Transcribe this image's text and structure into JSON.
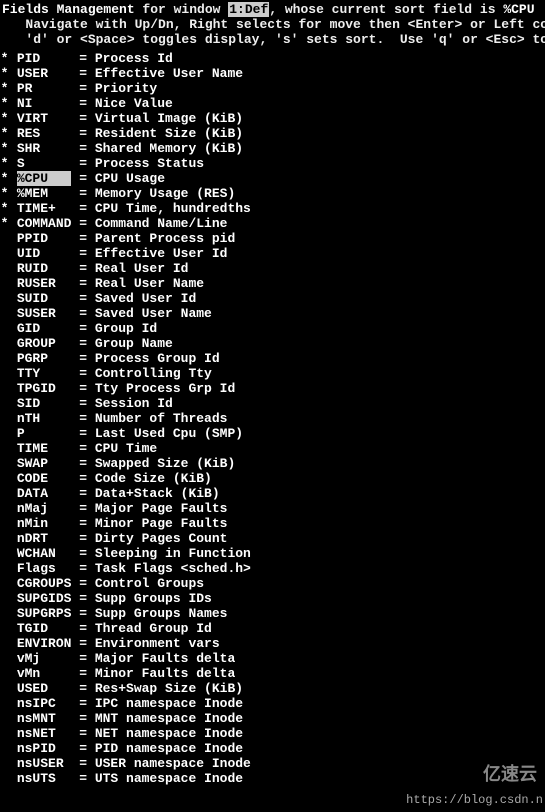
{
  "header": {
    "title": "Fields Management",
    "for_window_prefix": " for window ",
    "window": "1:Def",
    "sort_prefix": ", whose current sort field is ",
    "sort_field": "%CPU",
    "instr1": "   Navigate with Up/Dn, Right selects for move then <Enter> or Left commits,",
    "instr2": "   'd' or <Space> toggles display, 's' sets sort.  Use 'q' or <Esc> to end!"
  },
  "cursor_field": "%CPU",
  "fields": [
    {
      "on": true,
      "name": "PID",
      "desc": "Process Id"
    },
    {
      "on": true,
      "name": "USER",
      "desc": "Effective User Name"
    },
    {
      "on": true,
      "name": "PR",
      "desc": "Priority"
    },
    {
      "on": true,
      "name": "NI",
      "desc": "Nice Value"
    },
    {
      "on": true,
      "name": "VIRT",
      "desc": "Virtual Image (KiB)"
    },
    {
      "on": true,
      "name": "RES",
      "desc": "Resident Size (KiB)"
    },
    {
      "on": true,
      "name": "SHR",
      "desc": "Shared Memory (KiB)"
    },
    {
      "on": true,
      "name": "S",
      "desc": "Process Status"
    },
    {
      "on": true,
      "name": "%CPU",
      "desc": "CPU Usage"
    },
    {
      "on": true,
      "name": "%MEM",
      "desc": "Memory Usage (RES)"
    },
    {
      "on": true,
      "name": "TIME+",
      "desc": "CPU Time, hundredths"
    },
    {
      "on": true,
      "name": "COMMAND",
      "desc": "Command Name/Line"
    },
    {
      "on": false,
      "name": "PPID",
      "desc": "Parent Process pid"
    },
    {
      "on": false,
      "name": "UID",
      "desc": "Effective User Id"
    },
    {
      "on": false,
      "name": "RUID",
      "desc": "Real User Id"
    },
    {
      "on": false,
      "name": "RUSER",
      "desc": "Real User Name"
    },
    {
      "on": false,
      "name": "SUID",
      "desc": "Saved User Id"
    },
    {
      "on": false,
      "name": "SUSER",
      "desc": "Saved User Name"
    },
    {
      "on": false,
      "name": "GID",
      "desc": "Group Id"
    },
    {
      "on": false,
      "name": "GROUP",
      "desc": "Group Name"
    },
    {
      "on": false,
      "name": "PGRP",
      "desc": "Process Group Id"
    },
    {
      "on": false,
      "name": "TTY",
      "desc": "Controlling Tty"
    },
    {
      "on": false,
      "name": "TPGID",
      "desc": "Tty Process Grp Id"
    },
    {
      "on": false,
      "name": "SID",
      "desc": "Session Id"
    },
    {
      "on": false,
      "name": "nTH",
      "desc": "Number of Threads"
    },
    {
      "on": false,
      "name": "P",
      "desc": "Last Used Cpu (SMP)"
    },
    {
      "on": false,
      "name": "TIME",
      "desc": "CPU Time"
    },
    {
      "on": false,
      "name": "SWAP",
      "desc": "Swapped Size (KiB)"
    },
    {
      "on": false,
      "name": "CODE",
      "desc": "Code Size (KiB)"
    },
    {
      "on": false,
      "name": "DATA",
      "desc": "Data+Stack (KiB)"
    },
    {
      "on": false,
      "name": "nMaj",
      "desc": "Major Page Faults"
    },
    {
      "on": false,
      "name": "nMin",
      "desc": "Minor Page Faults"
    },
    {
      "on": false,
      "name": "nDRT",
      "desc": "Dirty Pages Count"
    },
    {
      "on": false,
      "name": "WCHAN",
      "desc": "Sleeping in Function"
    },
    {
      "on": false,
      "name": "Flags",
      "desc": "Task Flags <sched.h>"
    },
    {
      "on": false,
      "name": "CGROUPS",
      "desc": "Control Groups"
    },
    {
      "on": false,
      "name": "SUPGIDS",
      "desc": "Supp Groups IDs"
    },
    {
      "on": false,
      "name": "SUPGRPS",
      "desc": "Supp Groups Names"
    },
    {
      "on": false,
      "name": "TGID",
      "desc": "Thread Group Id"
    },
    {
      "on": false,
      "name": "ENVIRON",
      "desc": "Environment vars"
    },
    {
      "on": false,
      "name": "vMj",
      "desc": "Major Faults delta"
    },
    {
      "on": false,
      "name": "vMn",
      "desc": "Minor Faults delta"
    },
    {
      "on": false,
      "name": "USED",
      "desc": "Res+Swap Size (KiB)"
    },
    {
      "on": false,
      "name": "nsIPC",
      "desc": "IPC namespace Inode"
    },
    {
      "on": false,
      "name": "nsMNT",
      "desc": "MNT namespace Inode"
    },
    {
      "on": false,
      "name": "nsNET",
      "desc": "NET namespace Inode"
    },
    {
      "on": false,
      "name": "nsPID",
      "desc": "PID namespace Inode"
    },
    {
      "on": false,
      "name": "nsUSER",
      "desc": "USER namespace Inode"
    },
    {
      "on": false,
      "name": "nsUTS",
      "desc": "UTS namespace Inode"
    }
  ],
  "watermark": {
    "logo": "亿速云",
    "url": "https://blog.csdn.n"
  }
}
